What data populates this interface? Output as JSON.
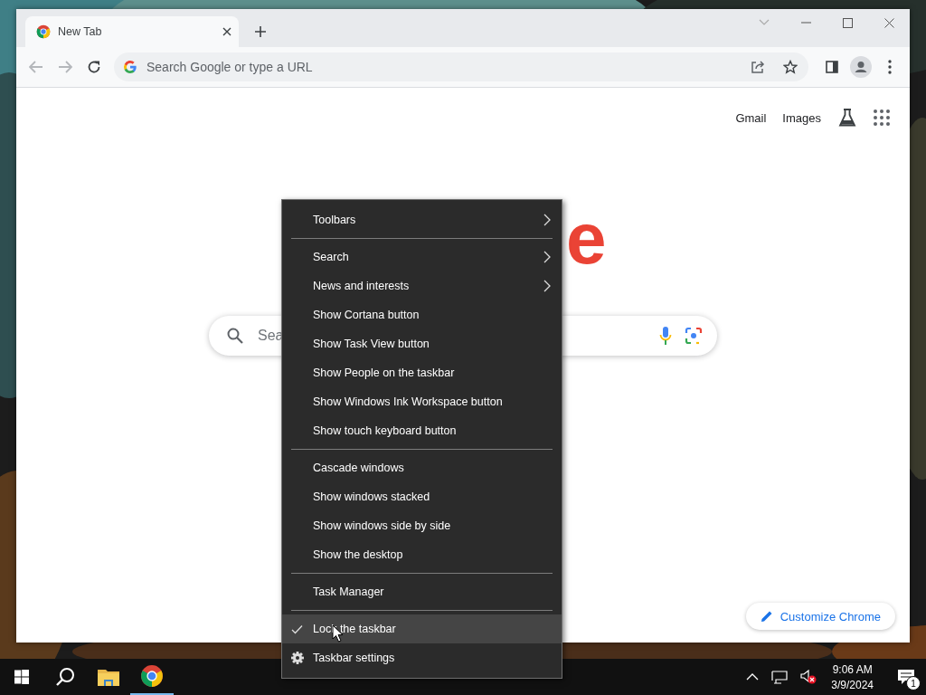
{
  "browser": {
    "tabs": [
      {
        "title": "New Tab",
        "selected": true
      }
    ],
    "nav": {
      "back": {
        "disabled": true
      },
      "forward": {
        "disabled": true
      }
    },
    "omnibox": {
      "placeholder": "Search Google or type a URL"
    },
    "header_links": [
      "Gmail",
      "Images"
    ],
    "logo_fragment": "e",
    "search": {
      "placeholder": "Sea"
    },
    "customize_button": "Customize Chrome"
  },
  "context_menu": {
    "sections": [
      [
        {
          "label": "Toolbars",
          "kind": "submenu",
          "hovered": false
        }
      ],
      [
        {
          "label": "Search",
          "kind": "submenu",
          "hovered": false
        },
        {
          "label": "News and interests",
          "kind": "submenu",
          "hovered": false
        },
        {
          "label": "Show Cortana button",
          "kind": "toggle",
          "checked": false,
          "hovered": false
        },
        {
          "label": "Show Task View button",
          "kind": "toggle",
          "checked": false,
          "hovered": false
        },
        {
          "label": "Show People on the taskbar",
          "kind": "toggle",
          "checked": false,
          "hovered": false
        },
        {
          "label": "Show Windows Ink Workspace button",
          "kind": "toggle",
          "checked": false,
          "hovered": false
        },
        {
          "label": "Show touch keyboard button",
          "kind": "toggle",
          "checked": false,
          "hovered": false
        }
      ],
      [
        {
          "label": "Cascade windows",
          "kind": "command",
          "hovered": false
        },
        {
          "label": "Show windows stacked",
          "kind": "command",
          "hovered": false
        },
        {
          "label": "Show windows side by side",
          "kind": "command",
          "hovered": false
        },
        {
          "label": "Show the desktop",
          "kind": "command",
          "hovered": false
        }
      ],
      [
        {
          "label": "Task Manager",
          "kind": "command",
          "hovered": false
        }
      ],
      [
        {
          "label": "Lock the taskbar",
          "kind": "toggle",
          "checked": true,
          "hovered": true
        },
        {
          "label": "Taskbar settings",
          "kind": "settings",
          "hovered": false
        }
      ]
    ]
  },
  "taskbar": {
    "apps": [
      {
        "kind": "explorer",
        "active": false
      },
      {
        "kind": "chrome",
        "active": true
      }
    ],
    "volume": {
      "muted": true
    },
    "clock": {
      "time": "9:06 AM",
      "date": "3/9/2024"
    },
    "notifications": {
      "count": "1"
    }
  }
}
